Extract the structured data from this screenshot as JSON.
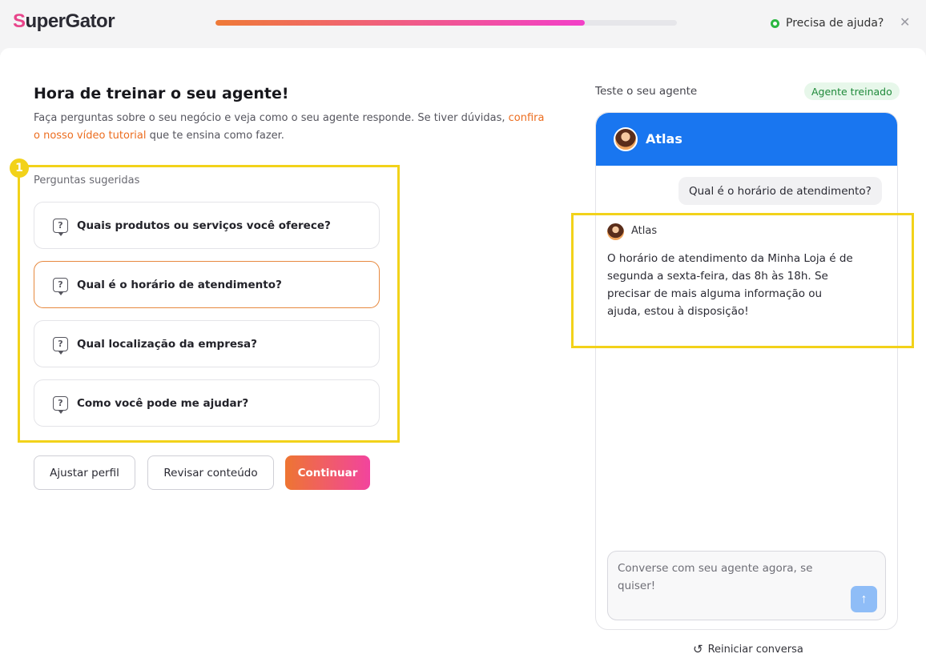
{
  "brand": {
    "logo_first": "S",
    "logo_rest": "uperGator"
  },
  "progress": {
    "percent": 80
  },
  "help": {
    "label": "Precisa de ajuda?"
  },
  "intro": {
    "title": "Hora de treinar o seu agente!",
    "subtitle_before": "Faça perguntas sobre o seu negócio e veja como o seu agente responde. Se tiver dúvidas, ",
    "subtitle_link": "confira o nosso vídeo tutorial",
    "subtitle_after": " que te ensina como fazer."
  },
  "annotation": {
    "badge": "1"
  },
  "suggestions": {
    "label": "Perguntas sugeridas",
    "items": [
      "Quais produtos ou serviços você oferece?",
      "Qual é o horário de atendimento?",
      "Qual localização da empresa?",
      "Como você pode me ajudar?"
    ],
    "active_index": 1
  },
  "actions": {
    "adjust_profile": "Ajustar perfil",
    "review_content": "Revisar conteúdo",
    "continue": "Continuar"
  },
  "test_panel": {
    "label": "Teste o seu agente",
    "badge": "Agente treinado",
    "agent_name": "Atlas",
    "user_message": "Qual é o horário de atendimento?",
    "bot_name": "Atlas",
    "bot_message": "O horário de atendimento da Minha Loja é de segunda a sexta-feira, das 8h às 18h. Se precisar de mais alguma informação ou ajuda, estou à disposição!",
    "input_placeholder": "Converse com seu agente agora, se quiser!",
    "restart_label": "Reiniciar conversa"
  },
  "colors": {
    "accent_orange": "#ec6d1f",
    "chat_header_blue": "#1976f0",
    "highlight_yellow": "#f2d21a",
    "trained_green": "#1f8a3a"
  },
  "icons": {
    "help": "whatsapp-icon",
    "close": "close-icon",
    "suggestion": "question-bubble-icon",
    "send": "arrow-up-icon",
    "restart": "restart-icon"
  }
}
